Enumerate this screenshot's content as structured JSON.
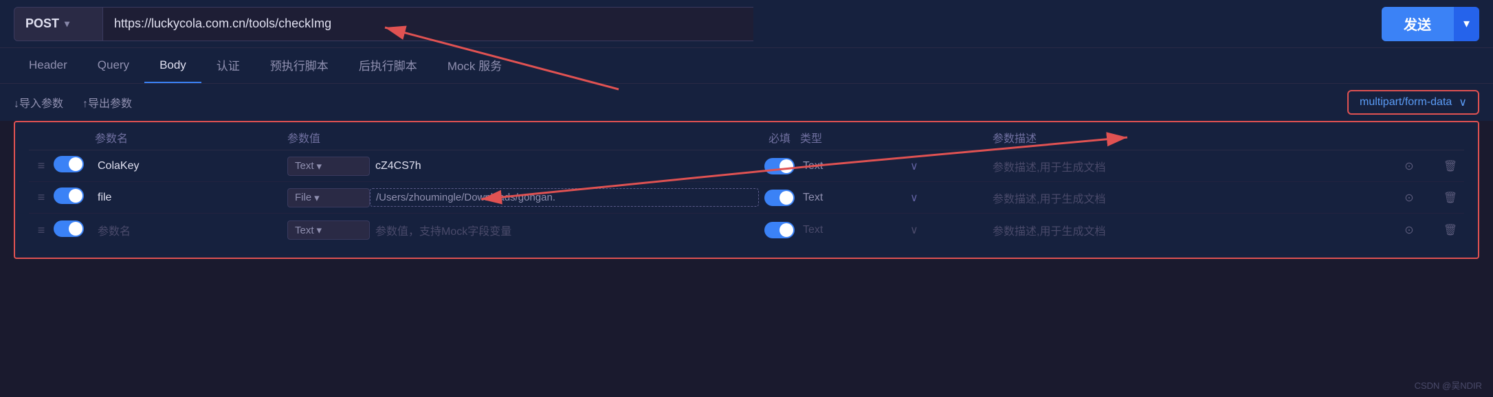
{
  "topbar": {
    "method": "POST",
    "method_chevron": "▾",
    "url": "https://luckycola.com.cn/tools/checkImg",
    "send_label": "发送",
    "send_dropdown_icon": "▾"
  },
  "nav": {
    "tabs": [
      {
        "label": "Header",
        "active": false
      },
      {
        "label": "Query",
        "active": false
      },
      {
        "label": "Body",
        "active": true
      },
      {
        "label": "认证",
        "active": false
      },
      {
        "label": "预执行脚本",
        "active": false
      },
      {
        "label": "后执行脚本",
        "active": false
      },
      {
        "label": "Mock 服务",
        "active": false
      }
    ]
  },
  "subtoolbar": {
    "import_label": "↓导入参数",
    "export_label": "↑导出参数",
    "content_type": "multipart/form-data",
    "content_type_chevron": "∨"
  },
  "table": {
    "headers": {
      "drag": "",
      "toggle": "",
      "param_name": "参数名",
      "type": "参数值",
      "value": "",
      "required": "必填",
      "type2": "类型",
      "type2_chevron": "",
      "desc": "参数描述",
      "action1": "",
      "action2": ""
    },
    "rows": [
      {
        "enabled": true,
        "param_name": "ColaKey",
        "type": "Text",
        "value": "cZ4CS7h",
        "required": true,
        "value_type": "Text",
        "desc": "参数描述,用于生成文档",
        "is_placeholder": false,
        "is_file": false
      },
      {
        "enabled": true,
        "param_name": "file",
        "type": "File",
        "value": "/Users/zhoumingle/Downloads/gongan.",
        "required": true,
        "value_type": "Text",
        "desc": "参数描述,用于生成文档",
        "is_placeholder": false,
        "is_file": true
      },
      {
        "enabled": true,
        "param_name": "参数名",
        "type": "Text",
        "value": "参数值，支持Mock字段变量",
        "required": true,
        "value_type": "Text",
        "desc": "参数描述,用于生成文档",
        "is_placeholder": true,
        "is_file": false
      }
    ]
  },
  "watermark": "CSDN @吴NDIR"
}
